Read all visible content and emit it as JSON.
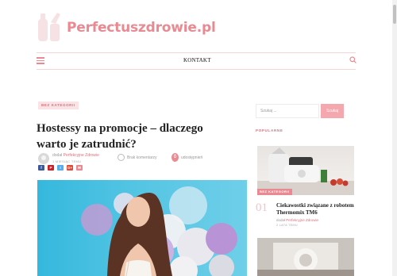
{
  "site": {
    "name": "Perfectuszdrowie.pl",
    "brand_color": "#e98a92"
  },
  "nav": {
    "menu_icon": "hamburger-icon",
    "kontakt_label": "KONTAKT",
    "search_icon": "search-icon"
  },
  "post": {
    "category": "BEZ KATEGORII",
    "title": "Hostessy na promocje – dlaczego warto je zatrudnić?",
    "author_prefix": "dodał",
    "author_name": "Perfekcyjne Zdrowie",
    "date": "1 MIESIĄC TEMU",
    "comments_label": "Brak komentarzy",
    "shares_count": "0",
    "shares_label": "udostępnień",
    "share_buttons": [
      {
        "icon": "facebook-icon",
        "glyph": "f",
        "color": "#3b5998"
      },
      {
        "icon": "pinterest-icon",
        "glyph": "P",
        "color": "#cb2027"
      },
      {
        "icon": "twitter-icon",
        "glyph": "t",
        "color": "#55acee"
      },
      {
        "icon": "google-plus-icon",
        "glyph": "G+",
        "color": "#dd4b39"
      },
      {
        "icon": "email-icon",
        "glyph": "✉",
        "color": "#e98a92"
      }
    ]
  },
  "sidebar": {
    "search_placeholder": "Szukaj ...",
    "search_button": "Szukaj",
    "popular_heading": "POPULARNE",
    "popular_posts": [
      {
        "number": "01",
        "category": "BEZ KATEGORII",
        "title": "Ciekawostki związane z robotem Thermomix TM6",
        "author_prefix": "dodał",
        "author_name": "Perfekcyjne Zdrowie",
        "date": "2 LATA TEMU"
      }
    ]
  }
}
